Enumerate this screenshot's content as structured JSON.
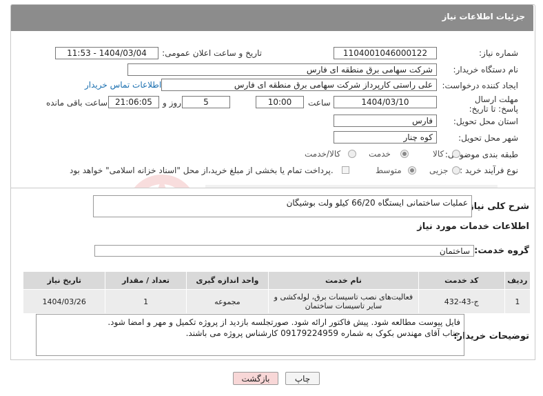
{
  "header": {
    "title": "جزئیات اطلاعات نیاز"
  },
  "fields": {
    "need_number_label": "شماره نیاز:",
    "need_number": "1104001046000122",
    "announce_label": "تاریخ و ساعت اعلان عمومی:",
    "announce_value": "1404/03/04 - 11:53",
    "buyer_org_label": "نام دستگاه خریدار:",
    "buyer_org": "شرکت سهامی برق منطقه ای فارس",
    "requester_label": "ایجاد کننده درخواست:",
    "requester": "علی راستی کارپرداز شرکت سهامی برق منطقه ای فارس",
    "contact_link": "اطلاعات تماس خریدار",
    "deadline_label": "مهلت ارسال پاسخ: تا تاریخ:",
    "deadline_date": "1404/03/10",
    "time_label": "ساعت",
    "deadline_time": "10:00",
    "days_value": "5",
    "days_label": "روز و",
    "remaining_time": "21:06:05",
    "remaining_label": "ساعت باقی مانده",
    "province_label": "استان محل تحویل:",
    "province": "فارس",
    "city_label": "شهر محل تحویل:",
    "city": "کوه چنار",
    "category_label": "طبقه بندی موضوعی:",
    "category_options": [
      "کالا",
      "خدمت",
      "کالا/خدمت"
    ],
    "process_label": "نوع فرآیند خرید :",
    "process_options": [
      "جزیی",
      "متوسط"
    ],
    "payment_note": "پرداخت تمام یا بخشی از مبلغ خرید،از محل \"اسناد خزانه اسلامی\" خواهد بود."
  },
  "summary": {
    "label": "شرح کلی نیاز:",
    "value": "عملیات ساختمانی ایستگاه 66/20 کیلو ولت بوشیگان"
  },
  "services": {
    "section_title": "اطلاعات خدمات مورد نیاز",
    "group_label": "گروه خدمت:",
    "group_value": "ساختمان",
    "columns": [
      "ردیف",
      "کد خدمت",
      "نام خدمت",
      "واحد اندازه گیری",
      "تعداد / مقدار",
      "تاریخ نیاز"
    ],
    "rows": [
      {
        "index": "1",
        "code": "ج-43-432",
        "name": "فعالیت‌های نصب تاسیسات برق، لوله‌کشی و سایر تاسیسات ساختمان",
        "unit": "مجموعه",
        "qty": "1",
        "date": "1404/03/26"
      }
    ]
  },
  "buyer_notes": {
    "label": "توضیحات خریدار:",
    "line1": "فایل پیوست مطالعه شود. پیش فاکتور ارائه شود. صورتجلسه بازدید از پروژه تکمیل و مهر و امضا شود.",
    "line2": "جناب آقای مهندس بکوک به شماره 09179224959 کارشناس پروژه می باشند."
  },
  "buttons": {
    "print": "چاپ",
    "back": "بازگشت"
  },
  "colors": {
    "header_bg": "#8c8c8c",
    "link": "#1a6fb0",
    "back_btn_bg": "#f8d7d7"
  }
}
